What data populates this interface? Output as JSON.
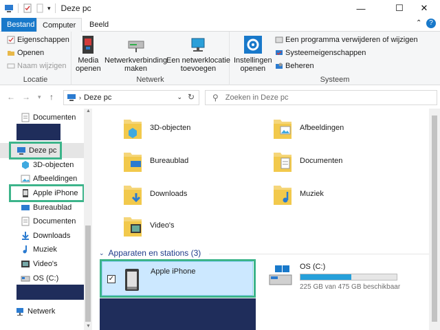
{
  "window": {
    "title": "Deze pc"
  },
  "ribbon_tabs": [
    "Bestand",
    "Computer",
    "Beeld"
  ],
  "ribbon": {
    "locatie": {
      "label": "Locatie",
      "properties": "Eigenschappen",
      "open": "Openen",
      "rename": "Naam wijzigen"
    },
    "netwerk": {
      "label": "Netwerk",
      "media_line1": "Media",
      "media_line2": "openen",
      "map_line1": "Netwerkverbinding",
      "map_line2": "maken",
      "add_line1": "Een netwerklocatie",
      "add_line2": "toevoegen"
    },
    "systeem": {
      "label": "Systeem",
      "settings_line1": "Instellingen",
      "settings_line2": "openen",
      "uninstall": "Een programma verwijderen of wijzigen",
      "sysprops": "Systeemeigenschappen",
      "manage": "Beheren"
    }
  },
  "address": {
    "path": "Deze pc"
  },
  "search": {
    "placeholder": "Zoeken in Deze pc"
  },
  "navpane": {
    "documents_top": "Documenten",
    "this_pc": "Deze pc",
    "items": [
      "3D-objecten",
      "Afbeeldingen",
      "Apple iPhone",
      "Bureaublad",
      "Documenten",
      "Downloads",
      "Muziek",
      "Video's",
      "OS (C:)"
    ],
    "network": "Netwerk"
  },
  "folders": [
    "3D-objecten",
    "Afbeeldingen",
    "Bureaublad",
    "Documenten",
    "Downloads",
    "Muziek",
    "Video's"
  ],
  "devices_header": "Apparaten en stations (3)",
  "devices": {
    "iphone": "Apple iPhone",
    "drive_name": "OS (C:)",
    "drive_free": "225 GB van 475 GB beschikbaar",
    "drive_used_fraction": 0.53
  },
  "colors": {
    "accent": "#1979ca",
    "highlight": "#3cb48a",
    "redaction": "#1f2d5b",
    "selected": "#cce8ff"
  }
}
